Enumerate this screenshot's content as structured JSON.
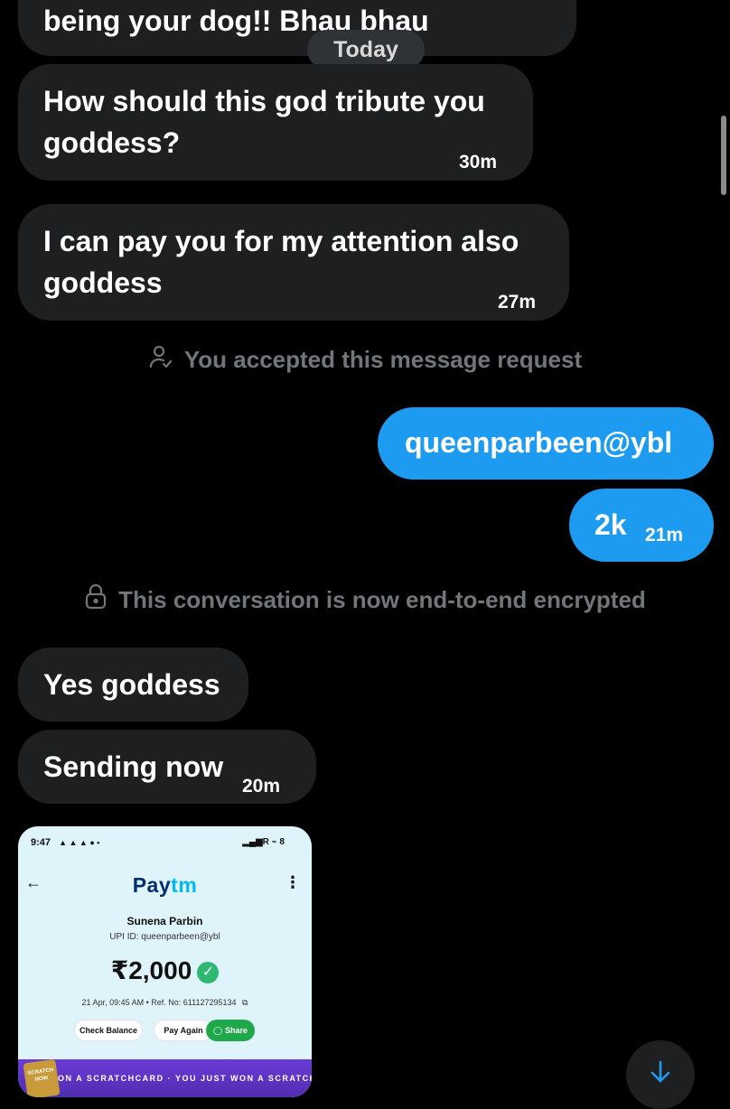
{
  "date_separator": "Today",
  "messages": {
    "m0": {
      "text": "being your dog!! Bhau bhau"
    },
    "m1": {
      "line1": "How should this god tribute you",
      "line2": "goddess?",
      "time": "30m"
    },
    "m2": {
      "line1": "I can pay you for my attention also",
      "line2": "goddess",
      "time": "27m"
    },
    "out1": {
      "text": "queenparbeen@ybl"
    },
    "out2": {
      "text": "2k",
      "time": "21m"
    },
    "m3": {
      "text": "Yes goddess"
    },
    "m4": {
      "text": "Sending now",
      "time": "20m"
    }
  },
  "system": {
    "accepted": "You accepted this message request",
    "encrypted": "This conversation is now end-to-end encrypted"
  },
  "attachment": {
    "status_time": "9:47",
    "status_icons": "▲ ▲ ▲ ● •",
    "status_right": "▂▄▆R ⌁ 8",
    "brand_pay": "Pay",
    "brand_tm": "tm",
    "payee_name": "Sunena Parbin",
    "upi_id": "UPI ID: queenparbeen@ybl",
    "amount": "₹2,000",
    "meta": "21 Apr, 09:45 AM  •  Ref. No: 611127295134",
    "check_balance": "Check Balance",
    "pay_again": "Pay Again",
    "share": "Share",
    "promo_text": "ON A SCRATCHCARD · YOU JUST WON A SCRATCHCA",
    "promo_card": "SCRATCH NOW"
  },
  "colors": {
    "incoming": "#1e1f21",
    "outgoing": "#1d9bf0",
    "system_text": "#71767b"
  }
}
